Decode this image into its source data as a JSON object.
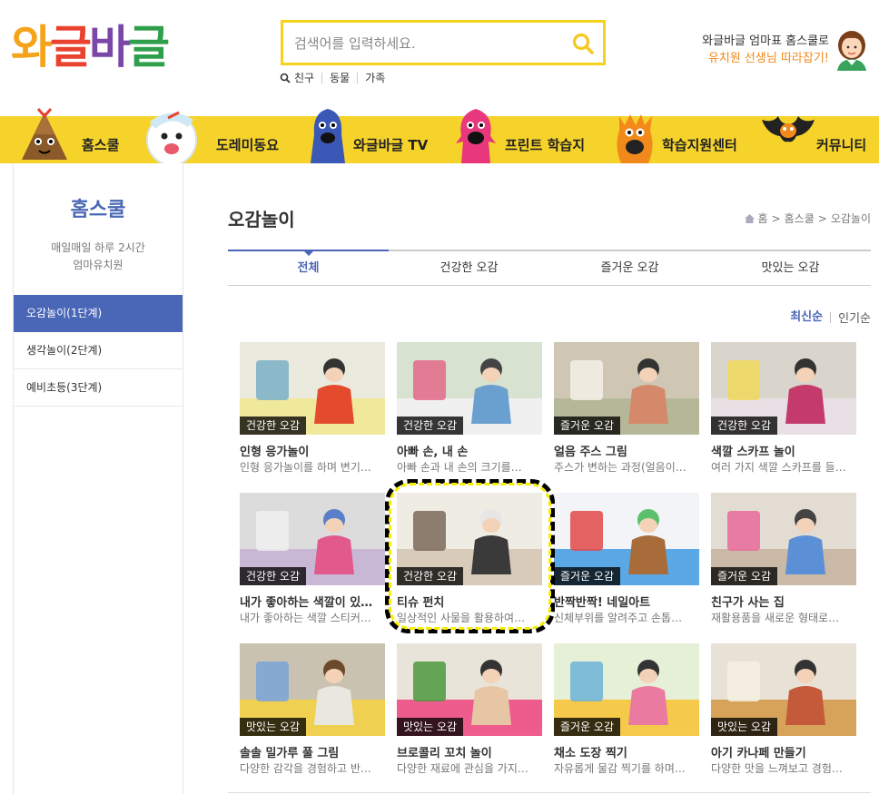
{
  "header": {
    "logo_chars": [
      {
        "ch": "와",
        "color": "#f5a31b"
      },
      {
        "ch": "글",
        "color": "#e9422e"
      },
      {
        "ch": "바",
        "color": "#7a46a8"
      },
      {
        "ch": "글",
        "color": "#2f9f4c"
      }
    ],
    "search_placeholder": "검색어를 입력하세요.",
    "keywords": [
      "친구",
      "동물",
      "가족"
    ],
    "promo_line1": "와글바글 엄마표 홈스쿨로",
    "promo_line2": "유치원 선생님 따라잡기!"
  },
  "gnb": [
    "홈스쿨",
    "도레미동요",
    "와글바글 TV",
    "프린트 학습지",
    "학습지원센터",
    "커뮤니티"
  ],
  "lnb": {
    "title": "홈스쿨",
    "desc1": "매일매일 하루 2시간",
    "desc2": "엄마유치원",
    "items": [
      "오감놀이(1단계)",
      "생각놀이(2단계)",
      "예비초등(3단계)"
    ]
  },
  "content": {
    "title": "오감놀이",
    "breadcrumb": [
      "홈",
      "홈스쿨",
      "오감놀이"
    ],
    "tabs": [
      "전체",
      "건강한 오감",
      "즐거운 오감",
      "맛있는 오감"
    ],
    "sort": [
      "최신순",
      "인기순"
    ],
    "cards": [
      {
        "cat": "건강한 오감",
        "title": "인형 응가놀이",
        "desc": "인형 응가놀이를 하며 변기…"
      },
      {
        "cat": "건강한 오감",
        "title": "아빠 손, 내 손",
        "desc": "아빠 손과 내 손의 크기를…"
      },
      {
        "cat": "즐거운 오감",
        "title": "얼음 주스 그림",
        "desc": "주스가 변하는 과정(얼음이…"
      },
      {
        "cat": "건강한 오감",
        "title": "색깔 스카프 놀이",
        "desc": "여러 가지 색깔 스카프를 들…"
      },
      {
        "cat": "건강한 오감",
        "title": "내가 좋아하는 색깔이 있…",
        "desc": "내가 좋아하는 색깔 스티커…"
      },
      {
        "cat": "건강한 오감",
        "title": "티슈 펀치",
        "desc": "일상적인 사물을 활용하여…"
      },
      {
        "cat": "즐거운 오감",
        "title": "반짝반짝! 네일아트",
        "desc": "신체부위를 알려주고 손톱…"
      },
      {
        "cat": "즐거운 오감",
        "title": "친구가 사는 집",
        "desc": "재활용품을 새로운 형태로…"
      },
      {
        "cat": "맛있는 오감",
        "title": "솔솔 밀가루 풀 그림",
        "desc": "다양한 감각을 경험하고 반…"
      },
      {
        "cat": "맛있는 오감",
        "title": "브로콜리 꼬치 놀이",
        "desc": "다양한 재료에 관심을 가지…"
      },
      {
        "cat": "즐거운 오감",
        "title": "채소 도장 찍기",
        "desc": "자유롭게 물감 찍기를 하며…"
      },
      {
        "cat": "맛있는 오감",
        "title": "아기 카나페 만들기",
        "desc": "다양한 맛을 느껴보고 경험…"
      }
    ]
  },
  "colors": {
    "accent": "#4a67b7",
    "nav_yellow": "#f6d32b",
    "search_border": "#f5d21e",
    "promo_orange": "#f08a1e"
  }
}
